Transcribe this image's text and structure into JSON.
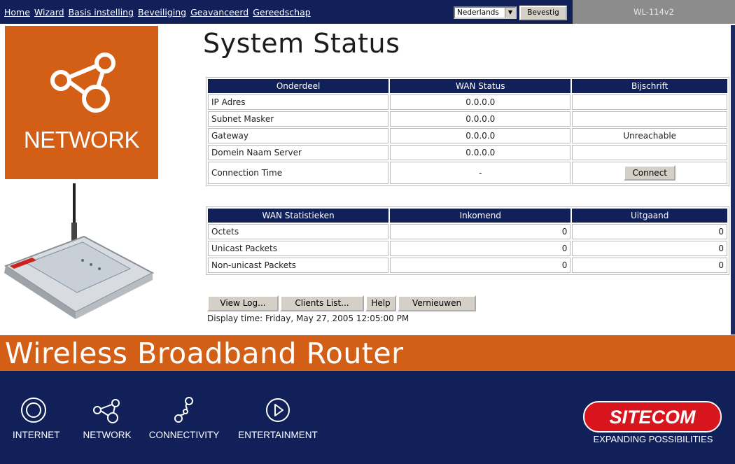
{
  "nav": {
    "links": [
      "Home",
      "Wizard",
      "Basis instelling",
      "Beveiliging",
      "Geavanceerd",
      "Gereedschap"
    ],
    "language": "Nederlands",
    "confirm_label": "Bevestig",
    "model": "WL-114v2"
  },
  "side": {
    "network_label": "NETWORK"
  },
  "main": {
    "title": "System Status",
    "wan_table": {
      "headers": [
        "Onderdeel",
        "WAN Status",
        "Bijschrift"
      ],
      "rows": [
        [
          "IP Adres",
          "0.0.0.0",
          ""
        ],
        [
          "Subnet Masker",
          "0.0.0.0",
          ""
        ],
        [
          "Gateway",
          "0.0.0.0",
          "Unreachable"
        ],
        [
          "Domein Naam Server",
          "0.0.0.0",
          ""
        ]
      ],
      "connection_time_label": "Connection Time",
      "connection_time_value": "-",
      "connect_label": "Connect"
    },
    "stats_table": {
      "headers": [
        "WAN Statistieken",
        "Inkomend",
        "Uitgaand"
      ],
      "rows": [
        [
          "Octets",
          "0",
          "0"
        ],
        [
          "Unicast Packets",
          "0",
          "0"
        ],
        [
          "Non-unicast Packets",
          "0",
          "0"
        ]
      ]
    },
    "buttons": {
      "view_log": "View Log...",
      "clients_list": "Clients List...",
      "help": "Help",
      "refresh": "Vernieuwen"
    },
    "display_time": "Display time: Friday, May 27, 2005 12:05:00 PM"
  },
  "banner": {
    "text": "Wireless Broadband Router"
  },
  "footer": {
    "items": [
      "INTERNET",
      "NETWORK",
      "CONNECTIVITY",
      "ENTERTAINMENT"
    ],
    "brand": "SITECOM",
    "tagline": "EXPANDING POSSIBILITIES"
  },
  "colors": {
    "navy": "#12205a",
    "orange": "#d35f16",
    "brand_red": "#d8141c"
  }
}
